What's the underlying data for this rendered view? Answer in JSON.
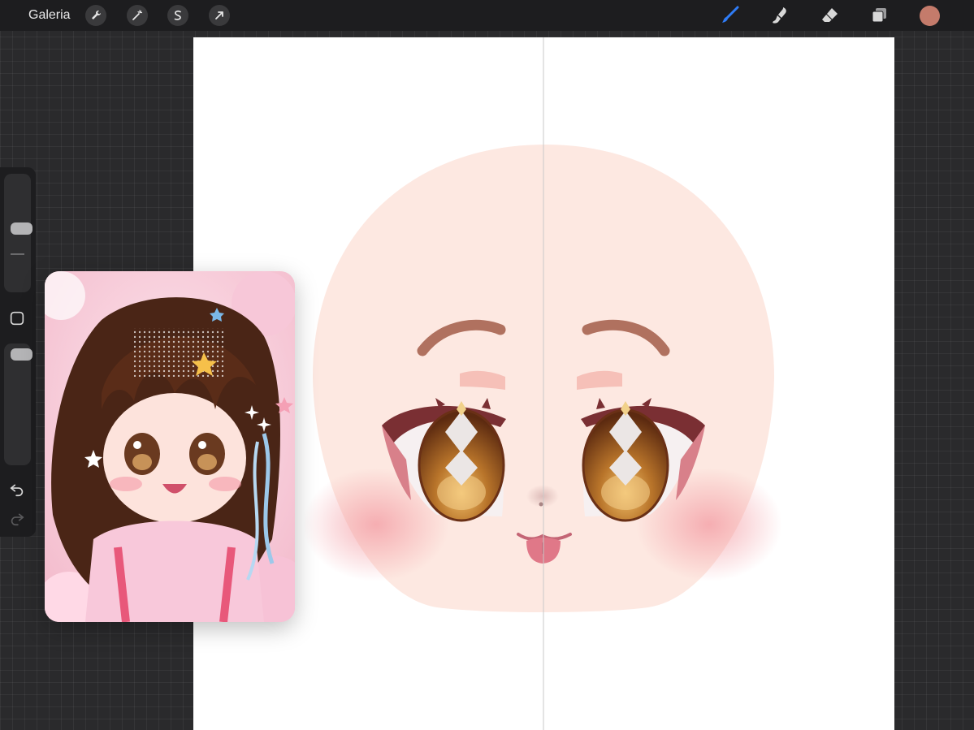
{
  "toolbar": {
    "gallery_label": "Galeria",
    "left_tools": [
      "wrench-icon",
      "magic-wand-icon",
      "selection-icon",
      "transform-arrow-icon"
    ],
    "right_tools": [
      "brush-icon",
      "smudge-icon",
      "eraser-icon",
      "layers-icon"
    ],
    "active_tool": "brush-icon",
    "current_color": "#c47b6b",
    "active_color": "#2f7cf6"
  },
  "sidebar": {
    "brush_size_fraction": 0.55,
    "opacity_fraction": 1.0,
    "icons": [
      "modify-square-icon",
      "undo-icon",
      "redo-icon"
    ]
  },
  "colors": {
    "skin": "#fde8e1",
    "eyebrow": "#b0715f",
    "blush": "#f6b6b6",
    "iris": "#8a4a1e",
    "mouth": "#e07888",
    "symmetry_line": "#c9c9c9"
  }
}
